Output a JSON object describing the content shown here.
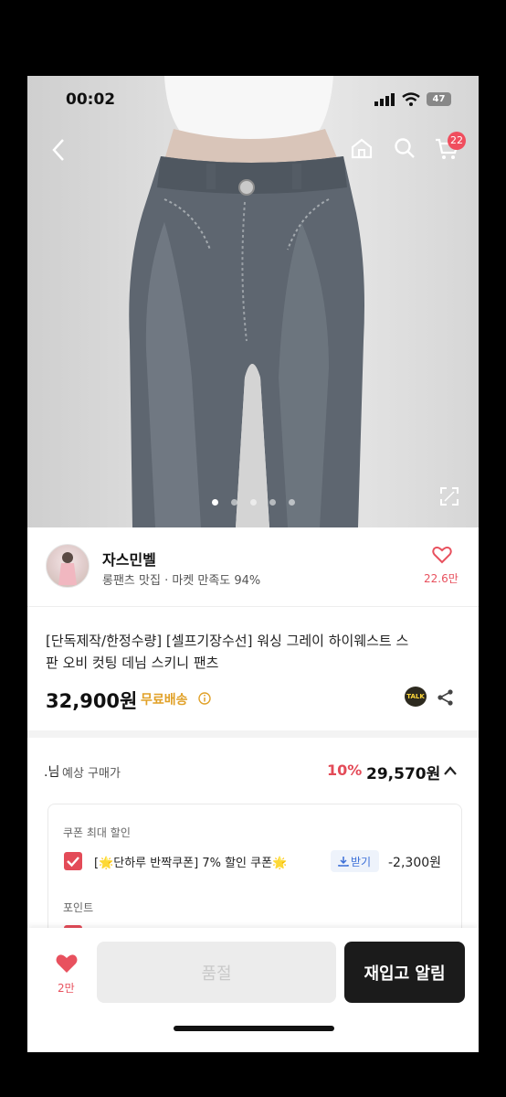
{
  "status_bar": {
    "time": "00:02",
    "battery": "47"
  },
  "header": {
    "cart_count": "22"
  },
  "gallery": {
    "image_count": 5,
    "active_index": 0
  },
  "seller": {
    "name": "자스민벨",
    "subtitle": "롱팬츠 맛집 · 마켓 만족도 94%",
    "likes": "22.6만"
  },
  "product": {
    "title_line1": "[단독제작/한정수량] [셀프기장수선] 워싱 그레이 하이웨스트 스",
    "title_line2": "판 오비 컷팅 데님 스키니 팬츠",
    "price": "32,900원",
    "shipping": "무료배송",
    "talk_label": "TALK"
  },
  "expected_price": {
    "label_prefix": ".님",
    "label": "예상 구매가",
    "discount": "10%",
    "price": "29,570원"
  },
  "coupon": {
    "section_title": "쿠폰 최대 할인",
    "item_text": "[🌟단하루 반짝쿠폰] 7% 할인 쿠폰🌟",
    "download_label": "받기",
    "amount": "-2,300원",
    "points_title": "포인트"
  },
  "bottom_bar": {
    "like_count": "2만",
    "soldout_label": "품절",
    "restock_label": "재입고 알림"
  },
  "colors": {
    "accent_red": "#e34b58",
    "like_red": "#e8515e",
    "shipping_gold": "#e1a128",
    "dark_button": "#1b1b1b"
  }
}
